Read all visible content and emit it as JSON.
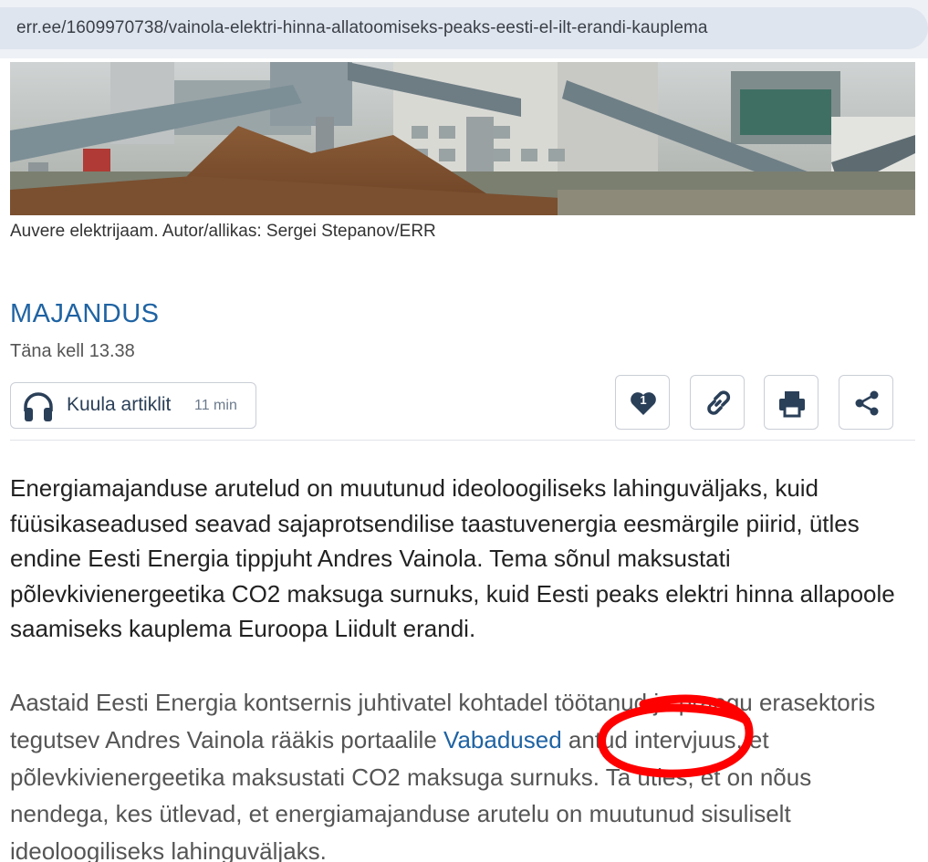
{
  "browser": {
    "url": "err.ee/1609970738/vainola-elektri-hinna-allatoomiseks-peaks-eesti-el-ilt-erandi-kauplema"
  },
  "article": {
    "image_caption": "Auvere elektrijaam. Autor/allikas: Sergei Stepanov/ERR",
    "category": "MAJANDUS",
    "date": "Täna kell 13.38",
    "listen": {
      "label": "Kuula artiklit",
      "duration": "11 min"
    },
    "actions": {
      "like_count": "1",
      "like_icon": "heart-icon",
      "link_icon": "link-icon",
      "print_icon": "printer-icon",
      "share_icon": "share-icon"
    },
    "lead": "Energiamajanduse arutelud on muutunud ideoloogiliseks lahinguväljaks, kuid füüsikaseadused seavad sajaprotsendilise taastuvenergia eesmärgile piirid, ütles endine Eesti Energia tippjuht Andres Vainola. Tema sõnul maksustati põlevkivienergeetika CO2 maksuga surnuks, kuid Eesti peaks elektri hinna allapoole saamiseks kauplema Euroopa Liidult erandi.",
    "body": {
      "before_link": "Aastaid Eesti Energia kontsernis juhtivatel kohtadel töötanud ja praegu erasektoris tegutsev Andres Vainola rääkis portaalile ",
      "link": "Vabadused",
      "after_link": " antud intervjuus, et põlevkivienergeetika maksustati CO2 maksuga surnuks. Ta ütles, et on nõus nendega, kes ütlevad, et energiamajanduse arutelu on muutunud sisuliselt ideoloogiliseks lahinguväljaks."
    }
  },
  "annotation": {
    "color": "#ff0000"
  }
}
